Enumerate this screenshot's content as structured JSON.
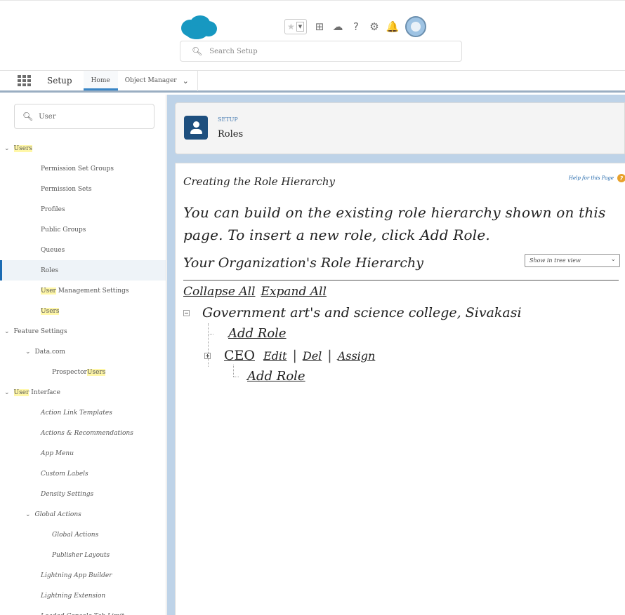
{
  "header": {
    "search_placeholder": "Search Setup",
    "icons": [
      "salesforce-cloud-logo",
      "favorites-star-icon",
      "add-icon",
      "trailhead-icon",
      "help-icon",
      "gear-icon",
      "notifications-bell-icon",
      "user-avatar"
    ]
  },
  "app_nav": {
    "app_name": "Setup",
    "tabs": [
      "Home",
      "Object Manager"
    ]
  },
  "sidebar": {
    "quick_find_value": "User",
    "items": [
      {
        "label_hl": "Users",
        "label_rest": "",
        "indent": 0,
        "chevron": true
      },
      {
        "label_hl": "",
        "label_rest": "Permission Set Groups",
        "indent": 1
      },
      {
        "label_hl": "",
        "label_rest": "Permission Sets",
        "indent": 1
      },
      {
        "label_hl": "",
        "label_rest": "Profiles",
        "indent": 1
      },
      {
        "label_hl": "",
        "label_rest": "Public Groups",
        "indent": 1
      },
      {
        "label_hl": "",
        "label_rest": "Queues",
        "indent": 1
      },
      {
        "label_hl": "",
        "label_rest": "Roles",
        "indent": 1,
        "selected": true
      },
      {
        "label_hl": "User",
        "label_rest": " Management Settings",
        "indent": 1
      },
      {
        "label_hl": "Users",
        "label_rest": "",
        "indent": 1
      },
      {
        "label_hl": "",
        "label_rest": "Feature Settings",
        "indent": 0,
        "chevron": true
      },
      {
        "label_hl": "",
        "label_rest": "Data.com",
        "indent": 1,
        "chevron": true
      },
      {
        "label_rest_pre": "Prospector ",
        "label_hl": "Users",
        "label_rest": "",
        "indent": 2
      },
      {
        "label_hl": "User",
        "label_rest": " Interface",
        "indent": 0,
        "chevron": true
      },
      {
        "label_hl": "",
        "label_rest": "Action Link Templates",
        "indent": 1,
        "italic": true
      },
      {
        "label_hl": "",
        "label_rest": "Actions & Recommendations",
        "indent": 1,
        "italic": true
      },
      {
        "label_hl": "",
        "label_rest": "App Menu",
        "indent": 1,
        "italic": true
      },
      {
        "label_hl": "",
        "label_rest": "Custom Labels",
        "indent": 1,
        "italic": true
      },
      {
        "label_hl": "",
        "label_rest": "Density Settings",
        "indent": 1,
        "italic": true
      },
      {
        "label_hl": "",
        "label_rest": "Global Actions",
        "indent": 1,
        "chevron": true,
        "italic": true
      },
      {
        "label_hl": "",
        "label_rest": "Global Actions",
        "indent": 2,
        "italic": true
      },
      {
        "label_hl": "",
        "label_rest": "Publisher Layouts",
        "indent": 2,
        "italic": true
      },
      {
        "label_hl": "",
        "label_rest": "Lightning App Builder",
        "indent": 1,
        "italic": true
      },
      {
        "label_hl": "",
        "label_rest": "Lightning Extension",
        "indent": 1,
        "italic": true
      },
      {
        "label_hl": "",
        "label_rest": "Loaded Console Tab Limit",
        "indent": 1,
        "italic": true
      }
    ]
  },
  "page_header": {
    "eyebrow": "SETUP",
    "title": "Roles"
  },
  "main": {
    "section_title": "Creating the Role Hierarchy",
    "help_link": "Help for this Page",
    "intro": "You can build on the existing role hierarchy shown on this page. To insert a new role, click Add Role.",
    "hierarchy_title": "Your Organization's Role Hierarchy",
    "view_select_value": "Show in tree view",
    "collapse_all": "Collapse All",
    "expand_all": "Expand All",
    "org_name": "Government art's and science college, Sivakasi",
    "add_role_1": "Add Role",
    "role_name": "CEO",
    "edit": "Edit",
    "del": "Del",
    "assign": "Assign",
    "separator": "|",
    "add_role_2": "Add Role"
  }
}
